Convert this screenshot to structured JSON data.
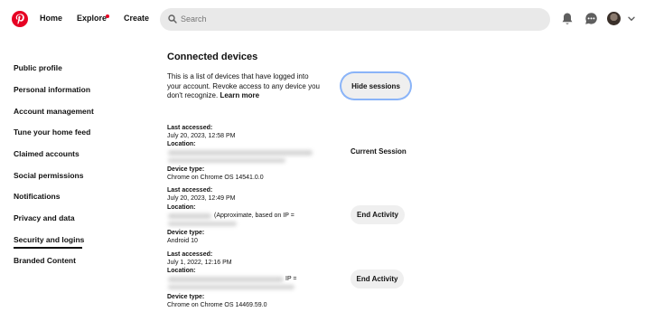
{
  "nav": {
    "home": "Home",
    "explore": "Explore",
    "create": "Create",
    "search_placeholder": "Search"
  },
  "sidebar": {
    "items": [
      {
        "label": "Public profile"
      },
      {
        "label": "Personal information"
      },
      {
        "label": "Account management"
      },
      {
        "label": "Tune your home feed"
      },
      {
        "label": "Claimed accounts"
      },
      {
        "label": "Social permissions"
      },
      {
        "label": "Notifications"
      },
      {
        "label": "Privacy and data"
      },
      {
        "label": "Security and logins",
        "active": true
      },
      {
        "label": "Branded Content"
      }
    ]
  },
  "main": {
    "title": "Connected devices",
    "intro": "This is a list of devices that have logged into your account. Revoke access to any device you don't recognize.",
    "learn_more": "Learn more",
    "hide_sessions": "Hide sessions",
    "current_session": "Current Session",
    "end_activity": "End Activity",
    "labels": {
      "last_accessed": "Last accessed:",
      "location": "Location:",
      "device_type": "Device type:"
    },
    "devices": [
      {
        "last_accessed": "July 20, 2023, 12:58 PM",
        "location_partial": "",
        "device_type": "Chrome on Chrome OS 14541.0.0"
      },
      {
        "last_accessed": "July 20, 2023, 12:49 PM",
        "location_partial": "(Approximate, based on IP =",
        "device_type": "Android 10"
      },
      {
        "last_accessed": "July 1, 2022, 12:16 PM",
        "location_partial": "IP =",
        "device_type": "Chrome on Chrome OS 14469.59.0"
      }
    ]
  },
  "colors": {
    "brand": "#e60023",
    "button_bg": "#efefef",
    "focus_ring": "#8ab4f8",
    "search_bg": "#e9e9e9"
  },
  "icons": [
    "pinterest-logo-icon",
    "search-icon",
    "bell-icon",
    "chat-icon",
    "chevron-down-icon"
  ]
}
